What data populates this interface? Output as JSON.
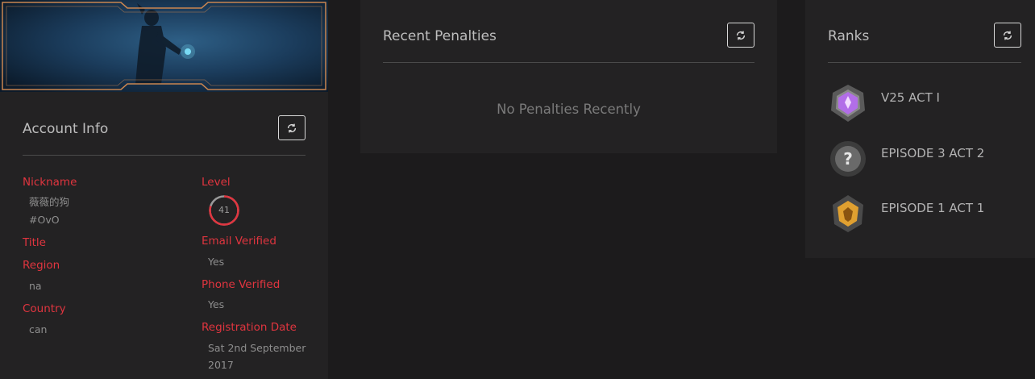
{
  "account": {
    "title": "Account Info",
    "nickname_label": "Nickname",
    "nickname_value": "薇薇的狗",
    "tag_value": "#OvO",
    "title_label": "Title",
    "region_label": "Region",
    "region_value": "na",
    "country_label": "Country",
    "country_value": "can",
    "level_label": "Level",
    "level_value": "41",
    "email_label": "Email Verified",
    "email_value": "Yes",
    "phone_label": "Phone Verified",
    "phone_value": "Yes",
    "registration_label": "Registration Date",
    "registration_line1": "Sat 2nd September",
    "registration_line2": "2017",
    "refresh_icon": "refresh-icon"
  },
  "penalties": {
    "title": "Recent Penalties",
    "empty_message": "No Penalties Recently",
    "refresh_icon": "refresh-icon"
  },
  "ranks": {
    "title": "Ranks",
    "refresh_icon": "refresh-icon",
    "items": [
      {
        "name": "V25 ACT I",
        "icon": "ascendant-rank-icon",
        "color": "#b26ee8"
      },
      {
        "name": "EPISODE 3 ACT 2",
        "icon": "unranked-question-icon",
        "color": "#6a6a6a"
      },
      {
        "name": "EPISODE 1 ACT 1",
        "icon": "gold-rank-icon",
        "color": "#e0a030"
      }
    ]
  },
  "colors": {
    "accent_red": "#e0353f",
    "background": "#1c1b1c",
    "panel": "#232223",
    "frame_orange": "#c98550"
  }
}
